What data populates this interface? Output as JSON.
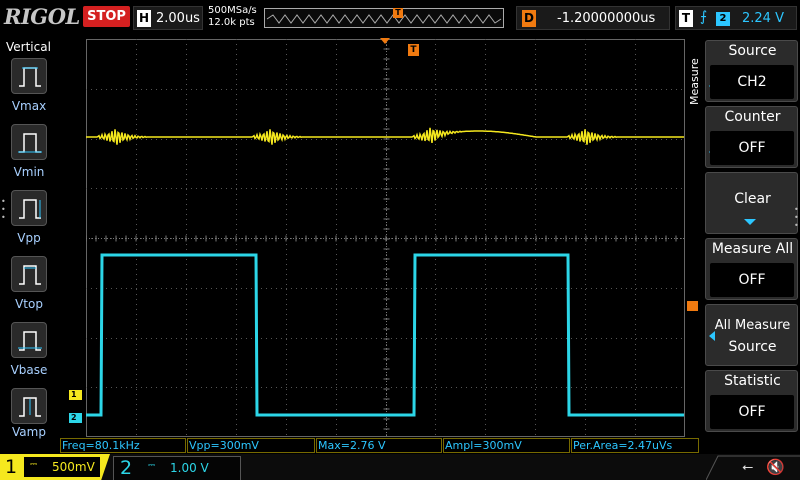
{
  "header": {
    "brand": "RIGOL",
    "run_state": "STOP",
    "horizontal": {
      "letter": "H",
      "timebase": "2.00us"
    },
    "sample_rate": "500MSa/s",
    "mem_depth": "12.0k pts",
    "delay": {
      "letter": "D",
      "value": "-1.20000000us"
    },
    "trigger": {
      "letter": "T",
      "edge_symbol": "⨍",
      "source": "2",
      "level": "2.24 V"
    },
    "memmap_trigger_letter": "T"
  },
  "left_menu": {
    "title": "Vertical",
    "items": [
      {
        "label": "Vmax",
        "icon": "vmax-icon"
      },
      {
        "label": "Vmin",
        "icon": "vmin-icon"
      },
      {
        "label": "Vpp",
        "icon": "vpp-icon"
      },
      {
        "label": "Vtop",
        "icon": "vtop-icon"
      },
      {
        "label": "Vbase",
        "icon": "vbase-icon"
      },
      {
        "label": "Vamp",
        "icon": "vamp-icon"
      }
    ]
  },
  "grid": {
    "ch1_marker": "1",
    "ch2_marker": "2",
    "trigger_marker": "T"
  },
  "right_menu": {
    "tab_label": "Measure",
    "source": {
      "title": "Source",
      "value": "CH2"
    },
    "counter": {
      "title": "Counter",
      "value": "OFF"
    },
    "clear": {
      "title": "Clear"
    },
    "measure_all": {
      "title": "Measure All",
      "value": "OFF"
    },
    "all_measure_source": {
      "line1": "All Measure",
      "line2": "Source"
    },
    "statistic": {
      "title": "Statistic",
      "value": "OFF"
    }
  },
  "measurements": [
    "Freq=80.1kHz",
    "Vpp=300mV",
    "Max=2.76 V",
    "Ampl=300mV",
    "Per.Area=2.47uVs"
  ],
  "channels": {
    "ch1": {
      "number": "1",
      "coupling": "⎓",
      "scale": "500mV",
      "color": "#f5e81e"
    },
    "ch2": {
      "number": "2",
      "coupling": "⎓",
      "scale": "1.00 V",
      "color": "#2cd6e8"
    }
  },
  "status_icons": [
    "usb-icon",
    "speaker-muted-icon"
  ],
  "colors": {
    "trigger_orange": "#f07a10",
    "stop_red": "#d42020",
    "accent_blue": "#2cc6ff"
  }
}
